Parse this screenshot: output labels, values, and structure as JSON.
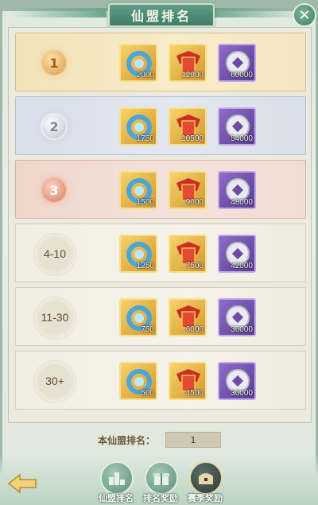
{
  "header": {
    "title": "仙盟排名",
    "close_glyph": "✕"
  },
  "rows": [
    {
      "rank": "1",
      "medal": "gold",
      "rewards": [
        "2000",
        "12000",
        "60000"
      ]
    },
    {
      "rank": "2",
      "medal": "silver",
      "rewards": [
        "1750",
        "10500",
        "54000"
      ]
    },
    {
      "rank": "3",
      "medal": "bronze",
      "rewards": [
        "1500",
        "9000",
        "48000"
      ]
    },
    {
      "rank": "4-10",
      "medal": "plain",
      "rewards": [
        "1250",
        "7500",
        "42000"
      ]
    },
    {
      "rank": "11-30",
      "medal": "plain",
      "rewards": [
        "750",
        "6000",
        "36000"
      ]
    },
    {
      "rank": "30+",
      "medal": "plain",
      "rewards": [
        "500",
        "4500",
        "30000"
      ]
    }
  ],
  "reward_icons": [
    "dragon-jade-icon",
    "contribution-token-icon",
    "silver-coin-icon"
  ],
  "footer": {
    "my_rank_label": "本仙盟排名：",
    "my_rank_value": "1"
  },
  "tabs": [
    {
      "label": "仙盟排名",
      "icon": "ranking-icon"
    },
    {
      "label": "排名奖励",
      "icon": "gift-icon"
    },
    {
      "label": "赛季奖励",
      "icon": "chest-icon",
      "active": true
    }
  ],
  "colors": {
    "accent": "#3f7e69",
    "gold": "#d5982f",
    "purple": "#5a3f94"
  }
}
